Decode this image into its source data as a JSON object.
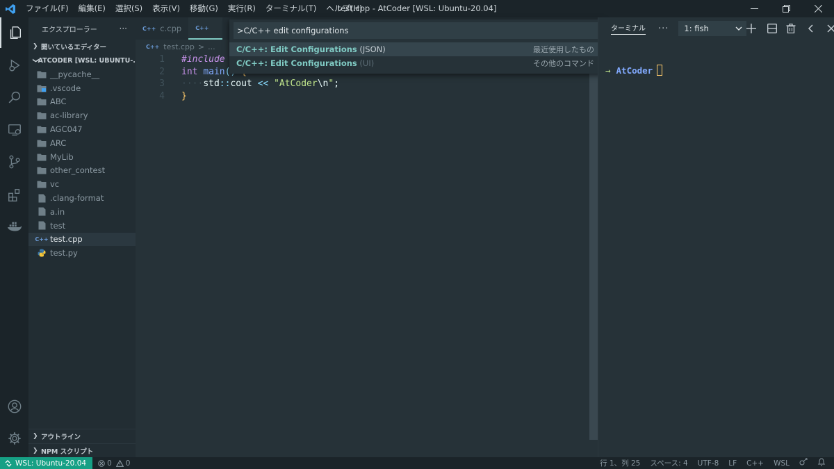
{
  "titlebar": {
    "menu": [
      "ファイル(F)",
      "編集(E)",
      "選択(S)",
      "表示(V)",
      "移動(G)",
      "実行(R)",
      "ターミナル(T)",
      "ヘルプ(H)"
    ],
    "window_title": "test.cpp - AtCoder [WSL: Ubuntu-20.04]"
  },
  "sidebar": {
    "title": "エクスプローラー",
    "more": "···",
    "open_editors": "開いているエディター",
    "folder": "ATCODER [WSL: UBUNTU-...",
    "items": [
      {
        "label": "__pycache__",
        "type": "folder"
      },
      {
        "label": ".vscode",
        "type": "vscode-folder"
      },
      {
        "label": "ABC",
        "type": "folder"
      },
      {
        "label": "ac-library",
        "type": "folder"
      },
      {
        "label": "AGC047",
        "type": "folder"
      },
      {
        "label": "ARC",
        "type": "folder"
      },
      {
        "label": "MyLib",
        "type": "folder"
      },
      {
        "label": "other_contest",
        "type": "folder"
      },
      {
        "label": "vc",
        "type": "folder"
      },
      {
        "label": ".clang-format",
        "type": "file"
      },
      {
        "label": "a.in",
        "type": "file"
      },
      {
        "label": "test",
        "type": "file"
      },
      {
        "label": "test.cpp",
        "type": "cpp",
        "selected": true
      },
      {
        "label": "test.py",
        "type": "python"
      }
    ],
    "outline": "アウトライン",
    "npm_scripts": "NPM スクリプト"
  },
  "editor": {
    "tabs": [
      {
        "label": "c.cpp",
        "active": false
      },
      {
        "label": "",
        "active": true
      }
    ],
    "breadcrumbs": {
      "file": "test.cpp",
      "sep": ">",
      "more": "..."
    },
    "lines": [
      {
        "n": "1",
        "text": "#include"
      },
      {
        "n": "2",
        "text": "int main() {"
      },
      {
        "n": "3",
        "text": "std::cout << \"AtCoder\\n\";",
        "indent": "····"
      },
      {
        "n": "4",
        "text": "}"
      }
    ]
  },
  "palette": {
    "input": ">C/C++ edit configurations",
    "items": [
      {
        "prefix": "C/C++: Edit Configurations",
        "suffix": "(JSON)",
        "tag": "最近使用したもの",
        "selected": true
      },
      {
        "prefix": "C/C++: Edit Configurations",
        "suffix": "(UI)",
        "tag": "その他のコマンド",
        "selected": false
      }
    ]
  },
  "terminal": {
    "tab": "ターミナル",
    "more": "···",
    "shell": "1: fish",
    "prompt_arrow": "→",
    "prompt_dir": "AtCoder"
  },
  "statusbar": {
    "remote": "WSL: Ubuntu-20.04",
    "errors": "0",
    "warnings": "0",
    "position": "行 1、列 25",
    "spaces": "スペース: 4",
    "encoding": "UTF-8",
    "eol": "LF",
    "language": "C++",
    "wsl": "WSL"
  },
  "colors": {
    "accent": "#80cbc4",
    "remote_bg": "#16a085",
    "background": "#263238"
  }
}
